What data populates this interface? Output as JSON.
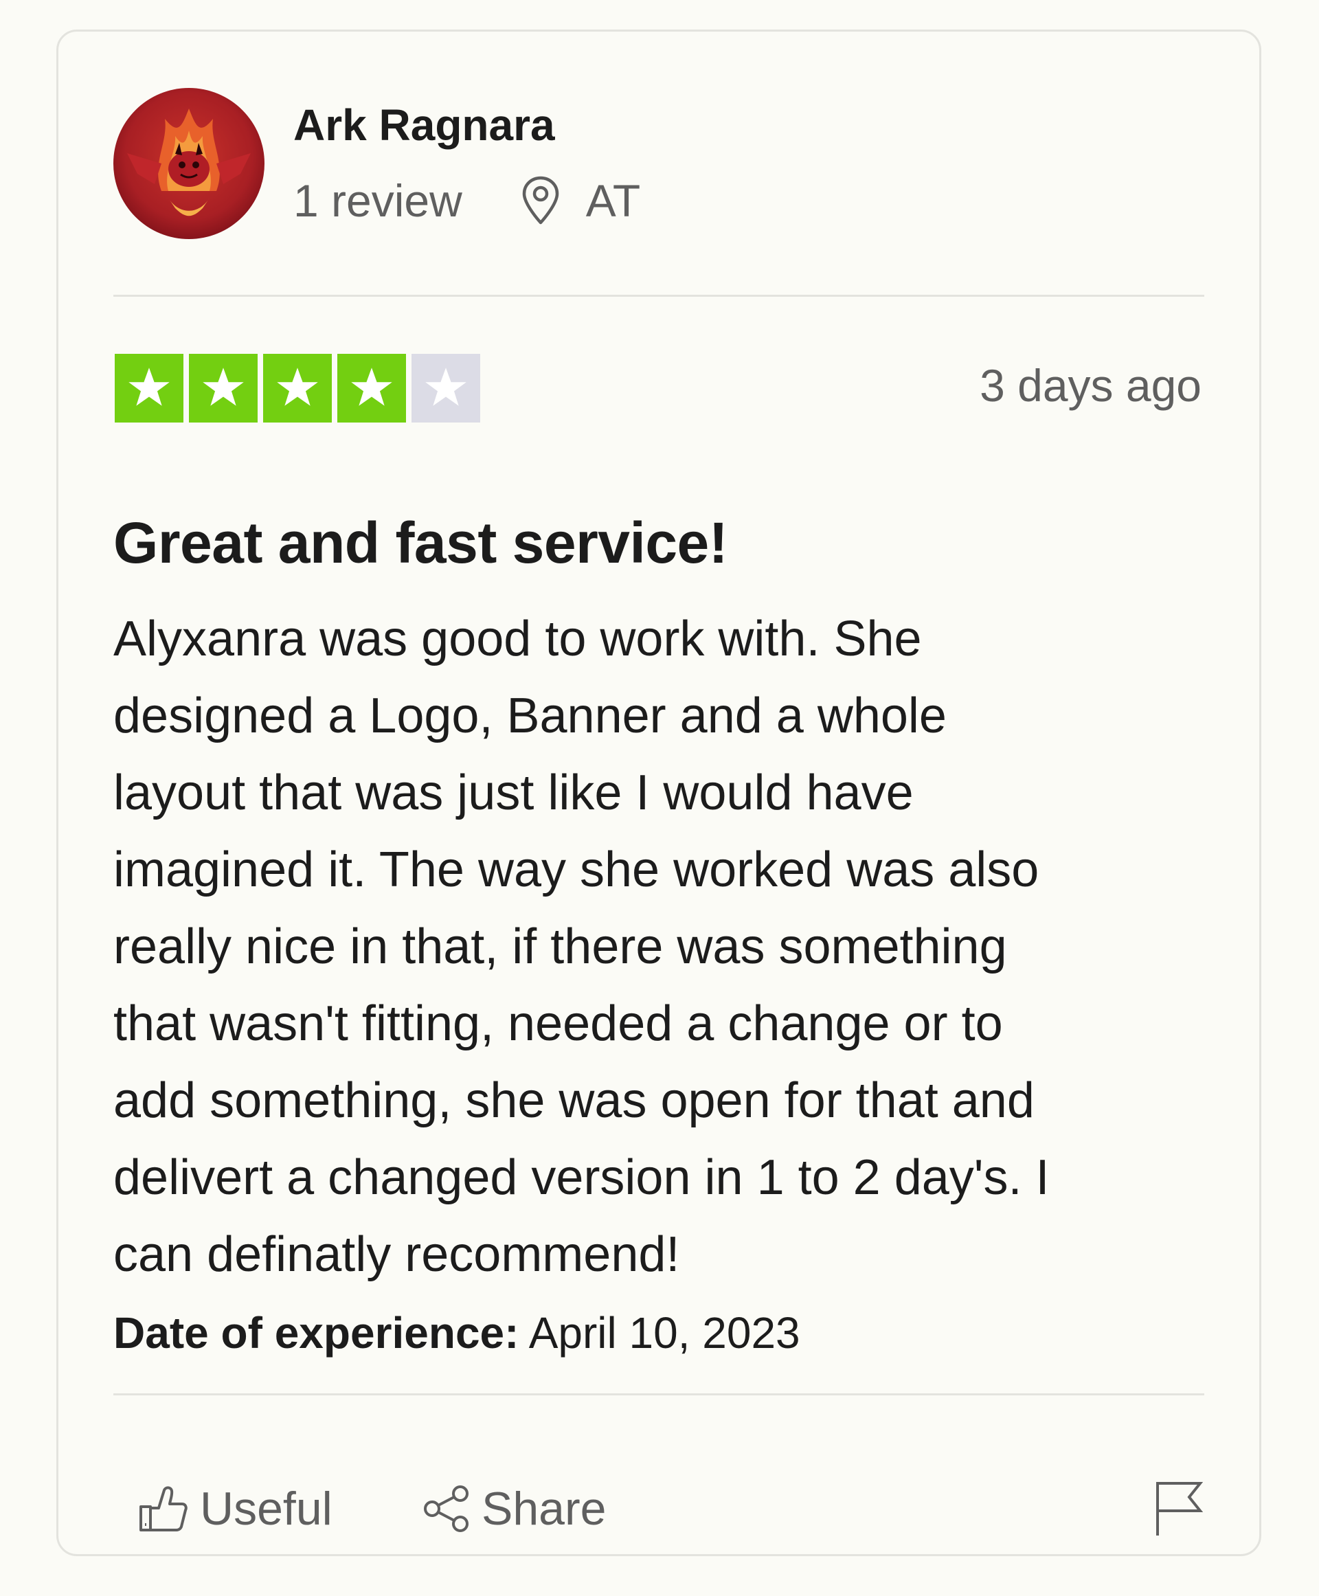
{
  "consumer": {
    "name": "Ark Ragnara",
    "review_count": "1 review",
    "country": "AT"
  },
  "rating": {
    "stars_filled": 4,
    "stars_total": 5,
    "star_color": "#73cf11",
    "empty_star_color": "#dcdce6"
  },
  "review": {
    "date": "3 days ago",
    "title": "Great and fast service!",
    "body_lines": [
      "Alyxanra was good to work with. She",
      "designed a Logo, Banner and a whole",
      "layout that was just like I would have",
      "imagined it. The way she worked was also",
      "really nice in that, if there was something",
      "that wasn't fitting, needed a change or to",
      "add something, she was open for that and",
      "delivert a changed version in 1 to 2 day's. I",
      "can definatly recommend!"
    ],
    "experience_label": "Date of experience:",
    "experience_date": " April 10, 2023"
  },
  "actions": {
    "useful_label": "Useful",
    "share_label": "Share"
  }
}
